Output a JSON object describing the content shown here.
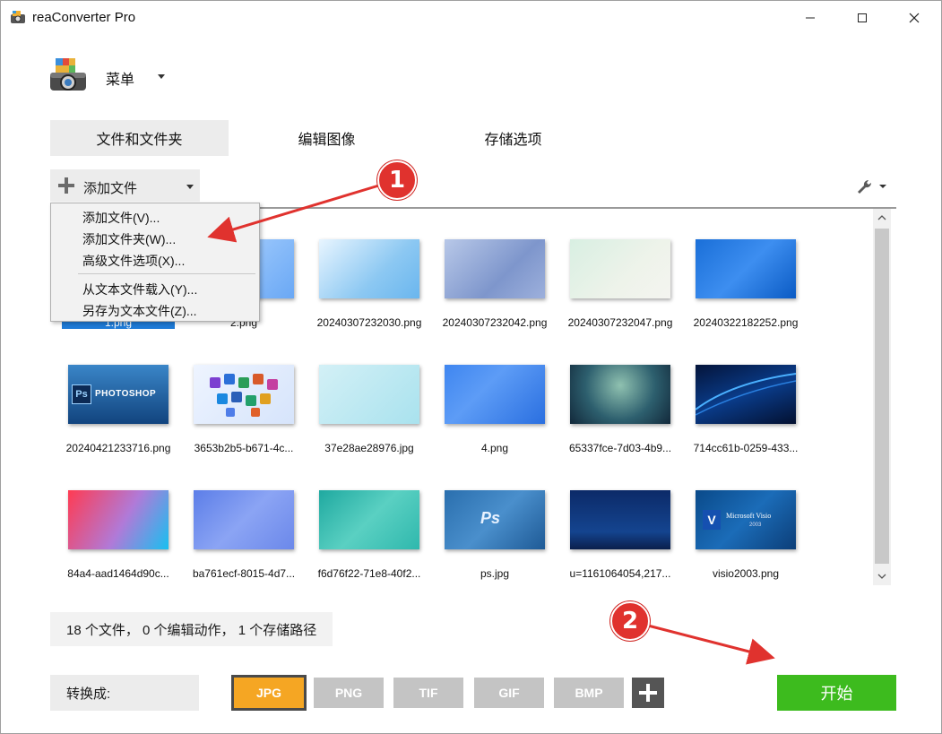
{
  "window": {
    "title": "reaConverter Pro"
  },
  "menu": {
    "label": "菜单"
  },
  "tabs": [
    {
      "label": "文件和文件夹",
      "active": true
    },
    {
      "label": "编辑图像",
      "active": false
    },
    {
      "label": "存储选项",
      "active": false
    }
  ],
  "add_files": {
    "label": "添加文件"
  },
  "dropdown": {
    "items": [
      "添加文件(V)...",
      "添加文件夹(W)...",
      "高级文件选项(X)...",
      "从文本文件载入(Y)...",
      "另存为文本文件(Z)..."
    ]
  },
  "files": [
    {
      "name": "1.png",
      "selected": true,
      "thumb": "t1"
    },
    {
      "name": "2.png",
      "selected": false,
      "thumb": "t2"
    },
    {
      "name": "20240307232030.png",
      "selected": false,
      "thumb": "t3"
    },
    {
      "name": "20240307232042.png",
      "selected": false,
      "thumb": "t4"
    },
    {
      "name": "20240307232047.png",
      "selected": false,
      "thumb": "t5"
    },
    {
      "name": "20240322182252.png",
      "selected": false,
      "thumb": "t6"
    },
    {
      "name": "20240421233716.png",
      "selected": false,
      "thumb": "t7"
    },
    {
      "name": "3653b2b5-b671-4c...",
      "selected": false,
      "thumb": "t8"
    },
    {
      "name": "37e28ae28976.jpg",
      "selected": false,
      "thumb": "t9"
    },
    {
      "name": "4.png",
      "selected": false,
      "thumb": "t10"
    },
    {
      "name": "65337fce-7d03-4b9...",
      "selected": false,
      "thumb": "t11"
    },
    {
      "name": "714cc61b-0259-433...",
      "selected": false,
      "thumb": "t12"
    },
    {
      "name": "84a4-aad1464d90c...",
      "selected": false,
      "thumb": "t13"
    },
    {
      "name": "ba761ecf-8015-4d7...",
      "selected": false,
      "thumb": "t14"
    },
    {
      "name": "f6d76f22-71e8-40f2...",
      "selected": false,
      "thumb": "t15"
    },
    {
      "name": "ps.jpg",
      "selected": false,
      "thumb": "t16"
    },
    {
      "name": "u=1161064054,217...",
      "selected": false,
      "thumb": "t17"
    },
    {
      "name": "visio2003.png",
      "selected": false,
      "thumb": "t18"
    }
  ],
  "thumb_text": {
    "photoshop": "PHOTOSHOP",
    "ps": "Ps",
    "visio_v": "V",
    "visio_title": "Microsoft Visio",
    "visio_year": "2003"
  },
  "status": {
    "text": "18 个文件， 0 个编辑动作， 1 个存储路径"
  },
  "convert": {
    "label": "转换成:",
    "formats": [
      {
        "label": "JPG",
        "active": true
      },
      {
        "label": "PNG",
        "active": false
      },
      {
        "label": "TIF",
        "active": false
      },
      {
        "label": "GIF",
        "active": false
      },
      {
        "label": "BMP",
        "active": false
      }
    ],
    "start_label": "开始"
  },
  "annotations": [
    {
      "label": "1"
    },
    {
      "label": "2"
    }
  ],
  "colors": {
    "accent_start": "#3dbb1e",
    "active_format": "#f5a623",
    "selection": "#1e7ad6",
    "annotation": "#e0322e"
  }
}
